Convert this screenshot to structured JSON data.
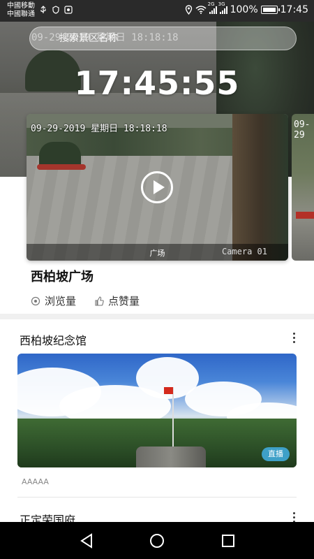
{
  "status_bar": {
    "carrier_1": "中國移動",
    "carrier_2": "中國聯通",
    "network_1": "2G",
    "network_2": "3G",
    "battery": "100%",
    "time": "17:45"
  },
  "hero": {
    "search_placeholder": "搜索景区名称",
    "clock": "17:45:55",
    "overlay_timestamp": "09-29-2019 星期日 18:18:18"
  },
  "featured": {
    "timestamp": "09-29-2019 星期日 18:18:18",
    "area_label": "广场",
    "camera_label": "Camera 01",
    "name": "西柏坡广场",
    "views_label": "浏览量",
    "likes_label": "点赞量",
    "next_timestamp": "09-29"
  },
  "sections": [
    {
      "title": "西柏坡纪念馆",
      "badge": "直播",
      "tag": "AAAAA"
    },
    {
      "title": "正定荣国府"
    }
  ],
  "icons": {
    "views": "eye-icon",
    "likes": "thumbs-up-icon",
    "more": "more-vertical-icon",
    "play": "play-icon"
  },
  "colors": {
    "live_badge": "#3ea0c8",
    "status_bar": "#2a2a2a",
    "nav_bar": "#000000"
  }
}
